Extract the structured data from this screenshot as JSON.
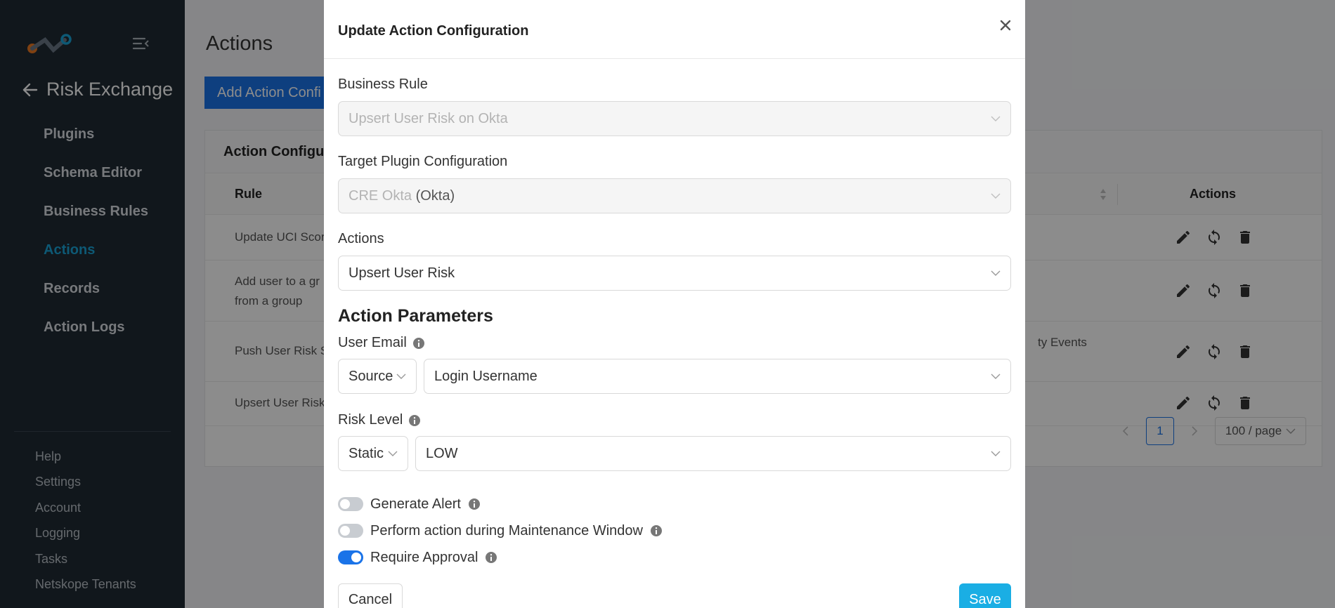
{
  "sidebar": {
    "title": "Risk Exchange",
    "nav": [
      {
        "label": "Plugins"
      },
      {
        "label": "Schema Editor"
      },
      {
        "label": "Business Rules"
      },
      {
        "label": "Actions",
        "active": true
      },
      {
        "label": "Records"
      },
      {
        "label": "Action Logs"
      }
    ],
    "bottom": [
      {
        "label": "Help"
      },
      {
        "label": "Settings"
      },
      {
        "label": "Account"
      },
      {
        "label": "Logging"
      },
      {
        "label": "Tasks"
      },
      {
        "label": "Netskope Tenants"
      }
    ]
  },
  "page": {
    "title": "Actions",
    "add_button": "Add Action Confi",
    "card_title": "Action Configur",
    "columns": {
      "rule": "Rule",
      "actions": "Actions"
    },
    "rows": [
      {
        "rule": "Update UCI Scor",
        "extra": ""
      },
      {
        "rule": "Add user to a gr",
        "rule2": "from a group",
        "extra": ""
      },
      {
        "rule": "Push User Risk S",
        "extra": "ty Events"
      },
      {
        "rule": "Upsert User Risk",
        "extra": ""
      }
    ],
    "pagination": {
      "current": "1",
      "per_page": "100 / page"
    }
  },
  "modal": {
    "title": "Update Action Configuration",
    "business_rule": {
      "label": "Business Rule",
      "value": "Upsert User Risk on Okta"
    },
    "target_plugin": {
      "label": "Target Plugin Configuration",
      "value": "CRE Okta",
      "suffix": "(Okta)"
    },
    "actions": {
      "label": "Actions",
      "value": "Upsert User Risk"
    },
    "params_title": "Action Parameters",
    "user_email": {
      "label": "User Email",
      "source": "Source",
      "value": "Login Username"
    },
    "risk_level": {
      "label": "Risk Level",
      "source": "Static",
      "value": "LOW"
    },
    "toggles": [
      {
        "label": "Generate Alert",
        "on": false
      },
      {
        "label": "Perform action during Maintenance Window",
        "on": false
      },
      {
        "label": "Require Approval",
        "on": true
      }
    ],
    "cancel_label": "Cancel",
    "save_label": "Save"
  },
  "colors": {
    "primary": "#1a73e8",
    "save": "#1aaee4",
    "sidebar": "#1f2a33",
    "active_nav": "#19a3d6"
  }
}
